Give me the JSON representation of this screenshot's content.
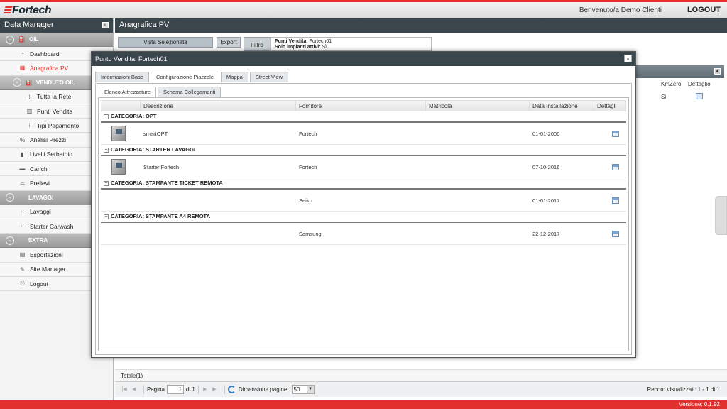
{
  "header": {
    "logo": "Fortech",
    "welcome": "Benvenuto/a Demo Clienti",
    "logout": "LOGOUT"
  },
  "sidebar": {
    "title": "Data Manager",
    "collapse_icon": "«",
    "groups": {
      "oil": "OIL",
      "venduto_oil": "VENDUTO OIL",
      "lavaggi": "LAVAGGI",
      "extra": "EXTRA"
    },
    "items": {
      "dashboard": "Dashboard",
      "anagrafica_pv": "Anagrafica PV",
      "tutta_la_rete": "Tutta la Rete",
      "punti_vendita": "Punti Vendita",
      "tipi_pagamento": "Tipi Pagamento",
      "analisi_prezzi": "Analisi Prezzi",
      "livelli_serbatoio": "Livelli Serbatoio",
      "carichi": "Carichi",
      "prelievi": "Prelievi",
      "lavaggi": "Lavaggi",
      "starter_carwash": "Starter Carwash",
      "esportazioni": "Esportazioni",
      "site_manager": "Site Manager",
      "logout": "Logout"
    }
  },
  "main": {
    "title": "Anagrafica PV",
    "toolbar": {
      "vista": "Vista Selezionata",
      "export": "Export",
      "filtro": "Filtro",
      "filter_pv_label": "Punti Vendita:",
      "filter_pv_value": "Fortech01",
      "filter_attivi_label": "Solo impianti attivi:",
      "filter_attivi_value": "Sì"
    },
    "background_grid": {
      "col_kmzero": "KmZero",
      "col_dettaglio": "Dettaglio",
      "row_kmzero": "Si"
    },
    "totale": "Totale(1)",
    "pager": {
      "pagina_label": "Pagina",
      "page_value": "1",
      "of_label": "di 1",
      "dimensione_label": "Dimensione pagine:",
      "page_size": "50",
      "records": "Record visualizzati: 1 - 1 di 1."
    }
  },
  "modal": {
    "title": "Punto Vendita: Fortech01",
    "close": "×",
    "tabs": [
      "Informazioni Base",
      "Configurazione Piazzale",
      "Mappa",
      "Street View"
    ],
    "subtabs": [
      "Elenco Attrezzature",
      "Schema Collegamenti"
    ],
    "columns": [
      "Descrizione",
      "Fornitore",
      "Matricola",
      "Data Installazione",
      "Dettagli"
    ],
    "categories": [
      {
        "label": "CATEGORIA: OPT",
        "rows": [
          {
            "descrizione": "smartOPT",
            "fornitore": "Fortech",
            "matricola": "",
            "data": "01-01-2000"
          }
        ]
      },
      {
        "label": "CATEGORIA: STARTER LAVAGGI",
        "rows": [
          {
            "descrizione": "Starter Fortech",
            "fornitore": "Fortech",
            "matricola": "",
            "data": "07-10-2016"
          }
        ]
      },
      {
        "label": "CATEGORIA: STAMPANTE TICKET REMOTA",
        "rows": [
          {
            "descrizione": "",
            "fornitore": "Seiko",
            "matricola": "",
            "data": "01-01-2017"
          }
        ]
      },
      {
        "label": "CATEGORIA: STAMPANTE A4 REMOTA",
        "rows": [
          {
            "descrizione": "",
            "fornitore": "Samsung",
            "matricola": "",
            "data": "22-12-2017"
          }
        ]
      }
    ]
  },
  "footer": {
    "version": "Versione: 0.1.92"
  },
  "colors": {
    "accent_red": "#e0312e",
    "dark_header": "#3a454c"
  }
}
